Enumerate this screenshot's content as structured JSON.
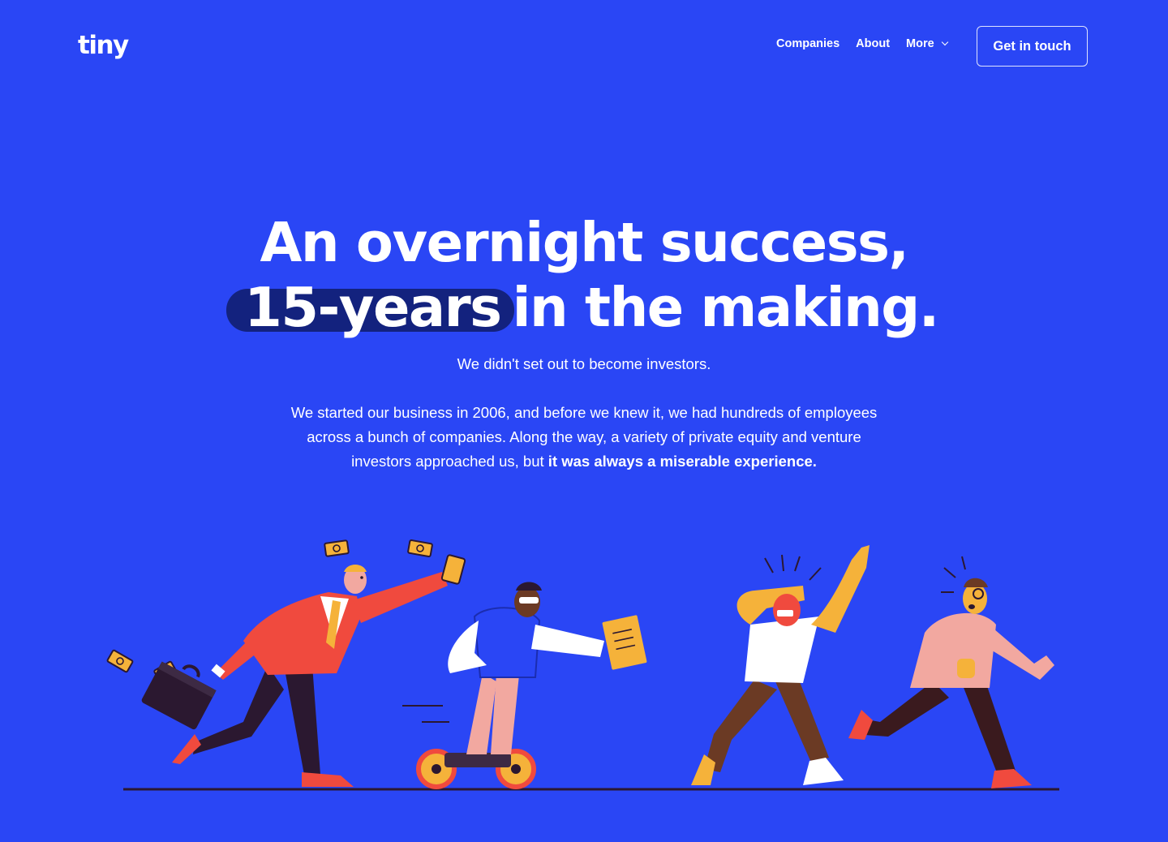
{
  "brand": {
    "logo_text": "tiny"
  },
  "nav": {
    "items": [
      {
        "label": "Companies"
      },
      {
        "label": "About"
      },
      {
        "label": "More"
      }
    ],
    "cta_label": "Get in touch"
  },
  "hero": {
    "line1": "An overnight success,",
    "highlight": "15-years",
    "line2_rest": "in the making.",
    "lead": "We didn't set out to become investors.",
    "para_main": "We started our business in 2006, and before we knew it, we had hundreds of employees across a bunch of companies. Along the way, a variety of private equity and venture investors approached us, but ",
    "para_bold": "it was always a miserable experience."
  },
  "colors": {
    "background": "#2a46f5",
    "highlight_pill": "#13227e",
    "text": "#ffffff",
    "accent_red": "#f04a3e",
    "accent_yellow": "#f5b23a",
    "skin_pink": "#f2a8a0",
    "dark_brown": "#3a1a1e"
  }
}
